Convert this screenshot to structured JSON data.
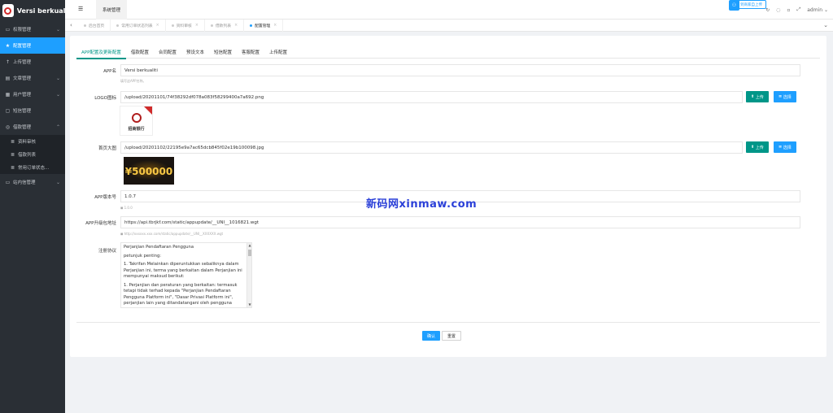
{
  "brand": {
    "title": "Versi berkualiti"
  },
  "sidebar": {
    "items": [
      {
        "label": "权限管理",
        "icon": "monitor-icon"
      },
      {
        "label": "配置管理",
        "icon": "star-icon"
      },
      {
        "label": "上传管理",
        "icon": "upload-icon"
      },
      {
        "label": "文章管理",
        "icon": "document-icon"
      },
      {
        "label": "用户管理",
        "icon": "users-icon"
      },
      {
        "label": "短信管理",
        "icon": "message-icon"
      },
      {
        "label": "借款管理",
        "icon": "money-icon"
      }
    ],
    "subitems": [
      {
        "label": "资料审核"
      },
      {
        "label": "借款列表"
      },
      {
        "label": "常用订单状态..."
      }
    ],
    "last_item": {
      "label": "站内信管理"
    }
  },
  "topbar": {
    "active_tab": "系统管理",
    "upload_badge": "到商家自上传",
    "user": "admin"
  },
  "page_tabs": [
    {
      "label": "后台首页"
    },
    {
      "label": "常用订单状态列表"
    },
    {
      "label": "资料审核"
    },
    {
      "label": "借款列表"
    },
    {
      "label": "配置管理"
    }
  ],
  "content_tabs": [
    "APP配置及更新配置",
    "借款配置",
    "合同配置",
    "预设文本",
    "短信配置",
    "客服配置",
    "上传配置"
  ],
  "form": {
    "app_name": {
      "label": "APP名",
      "value": "Versi berkualiti",
      "hint": "填写这APP名称。"
    },
    "logo": {
      "label": "LOGO图标",
      "value": "/upload/20201101/74f38292df078a083f58299400a7a692.png",
      "thumb_text": "招商银行"
    },
    "banner": {
      "label": "首页大图",
      "value": "/upload/20201102/22195e9a7ac65dcb845f02e19b100098.jpg",
      "thumb_text": "¥500000"
    },
    "version": {
      "label": "APP版本号",
      "value": "1.0.7",
      "hint": "1.0.0"
    },
    "update_url": {
      "label": "APP升级包地址",
      "value": "https://api.tbrjkf.com/static/appupdate/__UNI__1016821.wgt",
      "hint": "http://xxxxxx.xxx.com/static/appupdate/__UNI__XXXXXX.wgt"
    },
    "agreement": {
      "label": "注册协议",
      "paragraphs": [
        "Perjanjian Pendaftaran Pengguna",
        "petunjuk penting:",
        "1. Takrifan Melainkan diperuntukkan sebaliknya dalam Perjanjian ini, terma yang berkaitan dalam Perjanjian ini mempunyai maksud berikut:",
        "1. Perjanjian dan peraturan yang berkaitan: termasuk tetapi tidak terhad kepada \"Perjanjian Pendaftaran Pengguna Platform ini\", \"Dasar Privasi Platform ini\", perjanjian lain yang ditandatangani oleh pengguna melalui platform ini, serta peraturan dan dasar perniagaan yang digunakan dan"
      ]
    },
    "upload_label": "上传",
    "select_label": "选择",
    "submit_label": "确认",
    "reset_label": "重置"
  },
  "watermark": "新码网xinmaw.com",
  "colors": {
    "accent": "#1e9fff",
    "green": "#009688",
    "sidebar": "#2a2f35"
  }
}
